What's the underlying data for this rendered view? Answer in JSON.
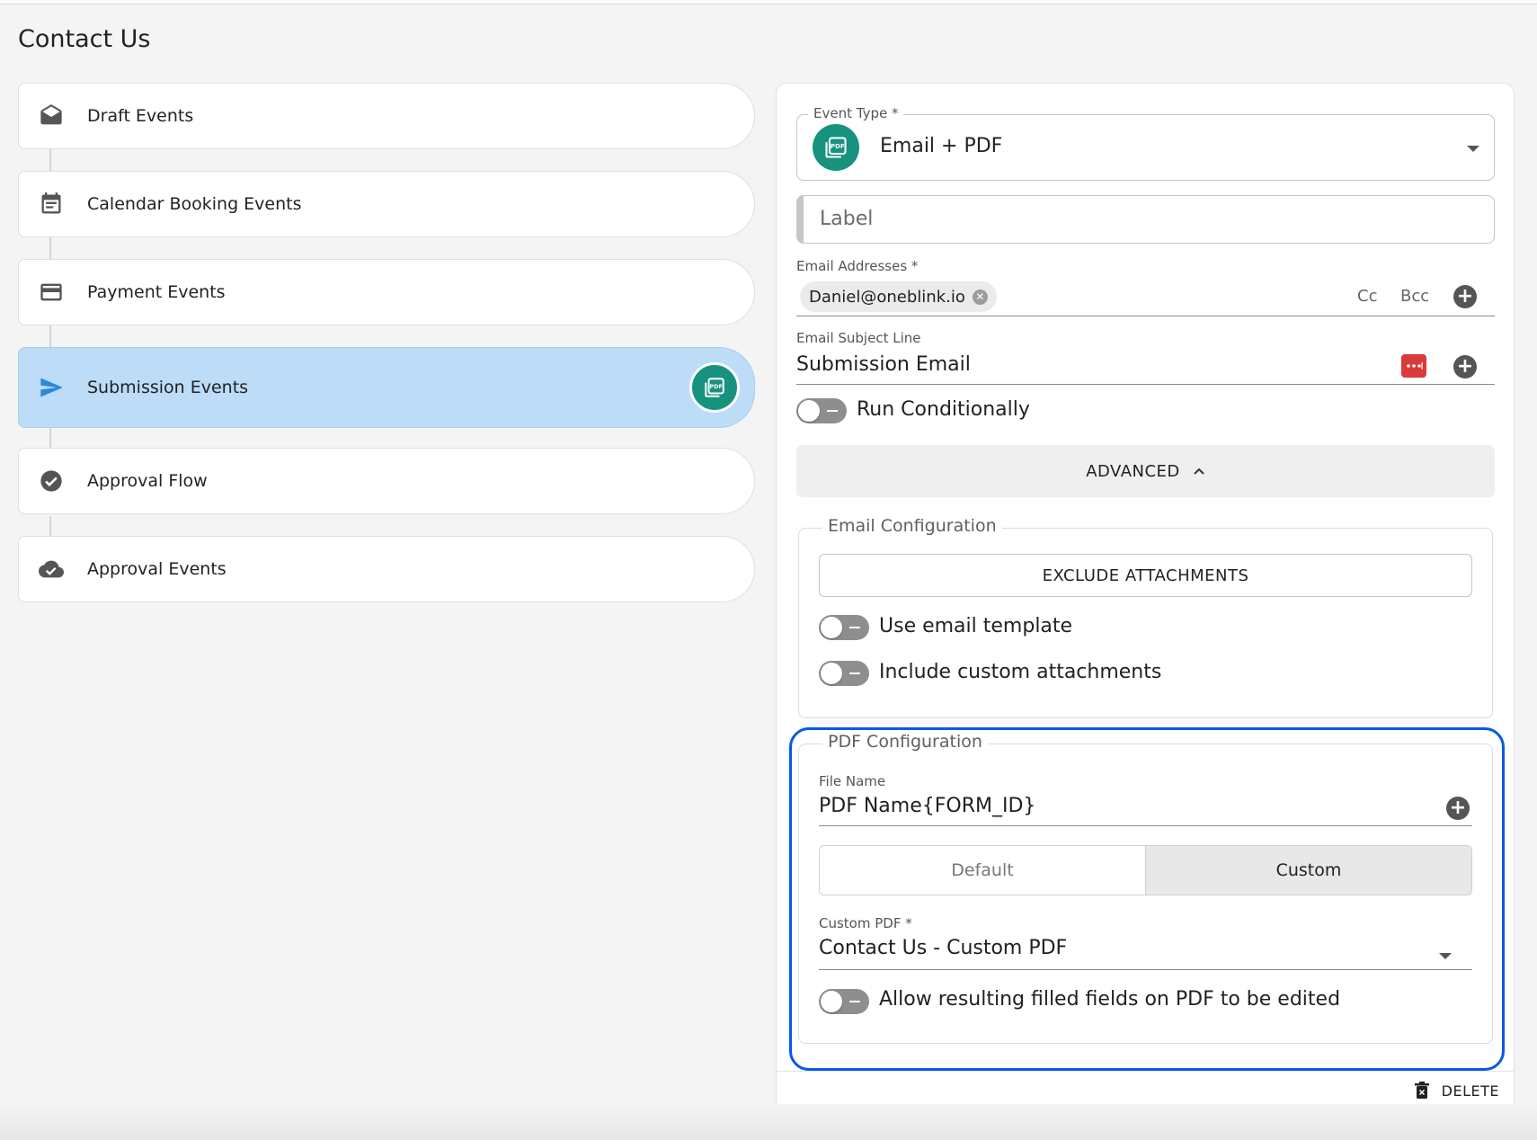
{
  "page": {
    "title": "Contact Us"
  },
  "stepper": {
    "items": [
      {
        "label": "Draft Events",
        "icon": "drafts-icon"
      },
      {
        "label": "Calendar Booking Events",
        "icon": "calendar-icon"
      },
      {
        "label": "Payment Events",
        "icon": "credit-card-icon"
      },
      {
        "label": "Submission Events",
        "icon": "send-icon",
        "active": true,
        "badge_icon": "pdf-icon"
      },
      {
        "label": "Approval Flow",
        "icon": "check-circle-icon"
      },
      {
        "label": "Approval Events",
        "icon": "cloud-done-icon"
      }
    ]
  },
  "form": {
    "event_type": {
      "label": "Event Type *",
      "value": "Email + PDF",
      "icon": "pdf-icon"
    },
    "label_field": {
      "placeholder": "Label"
    },
    "email_addresses": {
      "label": "Email Addresses *",
      "chips": [
        "Daniel@oneblink.io"
      ],
      "cc_label": "Cc",
      "bcc_label": "Bcc"
    },
    "subject": {
      "label": "Email Subject Line",
      "value": "Submission Email"
    },
    "run_conditionally": {
      "label": "Run Conditionally",
      "checked": false
    },
    "advanced_button": "ADVANCED",
    "email_config": {
      "legend": "Email Configuration",
      "exclude_attachments": "EXCLUDE ATTACHMENTS",
      "use_email_template": "Use email template",
      "include_custom_attachments": "Include custom attachments"
    },
    "pdf_config": {
      "legend": "PDF Configuration",
      "file_name_label": "File Name",
      "file_name_value": "PDF Name{FORM_ID}",
      "seg_default": "Default",
      "seg_custom": "Custom",
      "custom_pdf_label": "Custom PDF *",
      "custom_pdf_value": "Contact Us - Custom PDF",
      "allow_edit_label": "Allow resulting filled fields on PDF to be edited"
    },
    "delete_button": "DELETE"
  },
  "colors": {
    "accent_teal": "#17927f",
    "active_step_bg": "#bcdcf7",
    "highlight_blue": "#0a58e8",
    "send_icon_blue": "#2b8ad8",
    "variable_button_red": "#d93a3a"
  }
}
